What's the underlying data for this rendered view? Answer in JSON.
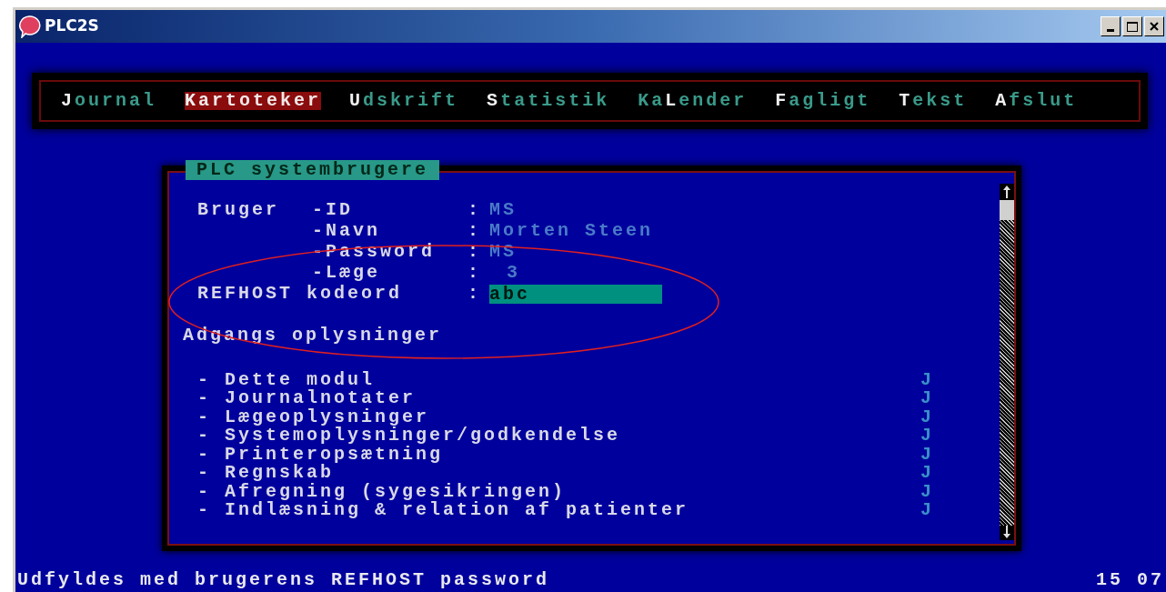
{
  "window": {
    "title": "PLC2S"
  },
  "menu": [
    {
      "hotkey": "J",
      "after": "ournal",
      "selected": false
    },
    {
      "hotkey": "K",
      "after": "artoteker",
      "selected": true
    },
    {
      "hotkey": "U",
      "after": "dskrift",
      "selected": false
    },
    {
      "hotkey": "S",
      "after": "tatistik",
      "selected": false
    },
    {
      "before": "Ka",
      "hotkey": "L",
      "after": "ender",
      "selected": false
    },
    {
      "hotkey": "F",
      "after": "agligt",
      "selected": false
    },
    {
      "hotkey": "T",
      "after": "ekst",
      "selected": false
    },
    {
      "hotkey": "A",
      "after": "fslut",
      "selected": false
    }
  ],
  "dialog": {
    "title": "PLC systembrugere",
    "user_group": {
      "label": "Bruger",
      "fields": [
        {
          "label": "-ID",
          "separator": ":",
          "value": "MS"
        },
        {
          "label": "-Navn",
          "separator": ":",
          "value": "Morten Steen"
        },
        {
          "label": "-Password",
          "separator": ":",
          "value": "MS"
        },
        {
          "label": "-Læge",
          "separator": ":",
          "value": "3",
          "kind": "number"
        }
      ]
    },
    "refhost": {
      "label": "REFHOST kodeord",
      "separator": ":",
      "value": "abc"
    },
    "access_heading": "Adgangs oplysninger",
    "access": [
      {
        "label": "- Dette modul",
        "value": "J"
      },
      {
        "label": "- Journalnotater",
        "value": "J"
      },
      {
        "label": "- Lægeoplysninger",
        "value": "J"
      },
      {
        "label": "- Systemoplysninger/godkendelse",
        "value": "J"
      },
      {
        "label": "- Printeropsætning",
        "value": "J"
      },
      {
        "label": "- Regnskab",
        "value": "J"
      },
      {
        "label": "- Afregning (sygesikringen)",
        "value": "J"
      },
      {
        "label": "- Indlæsning & relation af patienter",
        "value": "J"
      }
    ]
  },
  "status_bar": {
    "message": "Udfyldes med brugerens REFHOST password",
    "time": "15 07"
  }
}
